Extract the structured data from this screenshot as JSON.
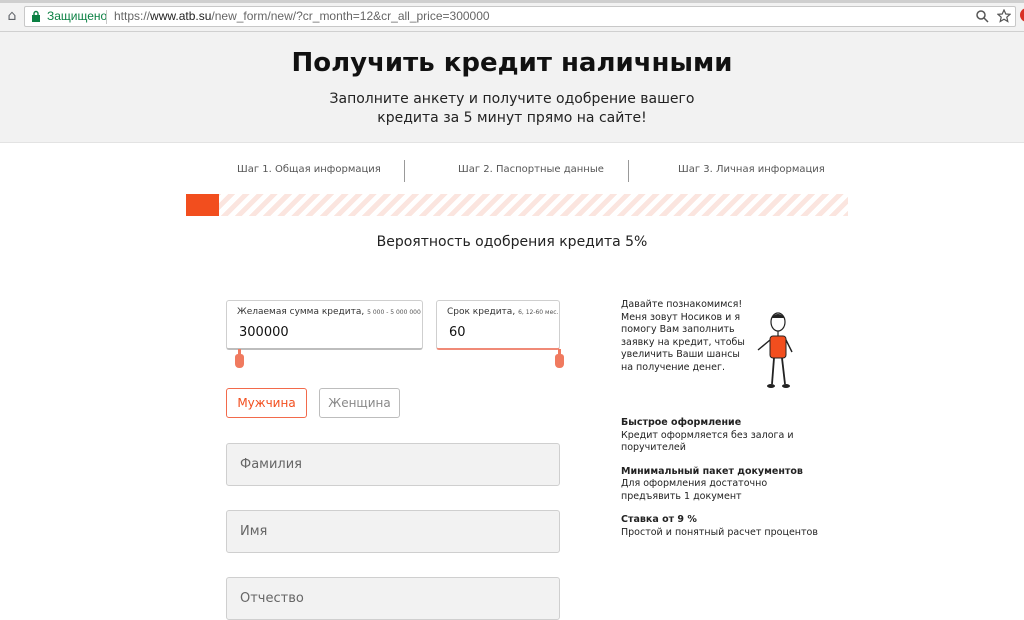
{
  "browser": {
    "secure_label": "Защищено",
    "url_scheme": "https://",
    "url_host": "www.atb.su",
    "url_path": "/new_form/new/?cr_month=12&cr_all_price=300000"
  },
  "header": {
    "title": "Получить кредит наличными",
    "subtitle_line1": "Заполните анкету и получите одобрение вашего",
    "subtitle_line2": "кредита за 5 минут прямо на сайте!"
  },
  "steps": [
    {
      "prefix": "Шаг 1.",
      "label": "Общая информация"
    },
    {
      "prefix": "Шаг 2.",
      "label": "Паспортные данные"
    },
    {
      "prefix": "Шаг 3.",
      "label": "Личная информация"
    }
  ],
  "progress": {
    "fraction": 0.05,
    "text": "Вероятность одобрения кредита 5%"
  },
  "amount": {
    "label": "Желаемая сумма кредита,",
    "range": "5 000 - 5 000 000",
    "value": "300000"
  },
  "term": {
    "label": "Срок кредита,",
    "range": "6, 12-60 мес.",
    "value": "60"
  },
  "gender": {
    "male": "Мужчина",
    "female": "Женщина",
    "selected": "male"
  },
  "fields": {
    "last_name": "Фамилия",
    "first_name": "Имя",
    "middle_name": "Отчество"
  },
  "assistant": {
    "intro": "Давайте познакомимся! Меня зовут Носиков и я помогу Вам заполнить заявку на кредит, чтобы увеличить Ваши шансы на получение денег."
  },
  "benefits": [
    {
      "title": "Быстрое оформление",
      "text": "Кредит оформляется без залога и поручителей"
    },
    {
      "title": "Минимальный пакет документов",
      "text": "Для оформления достаточно предъявить 1 документ"
    },
    {
      "title": "Ставка от 9 %",
      "text": "Простой и понятный расчет процентов"
    }
  ],
  "colors": {
    "accent": "#f24e1e",
    "secure": "#0b8043"
  }
}
